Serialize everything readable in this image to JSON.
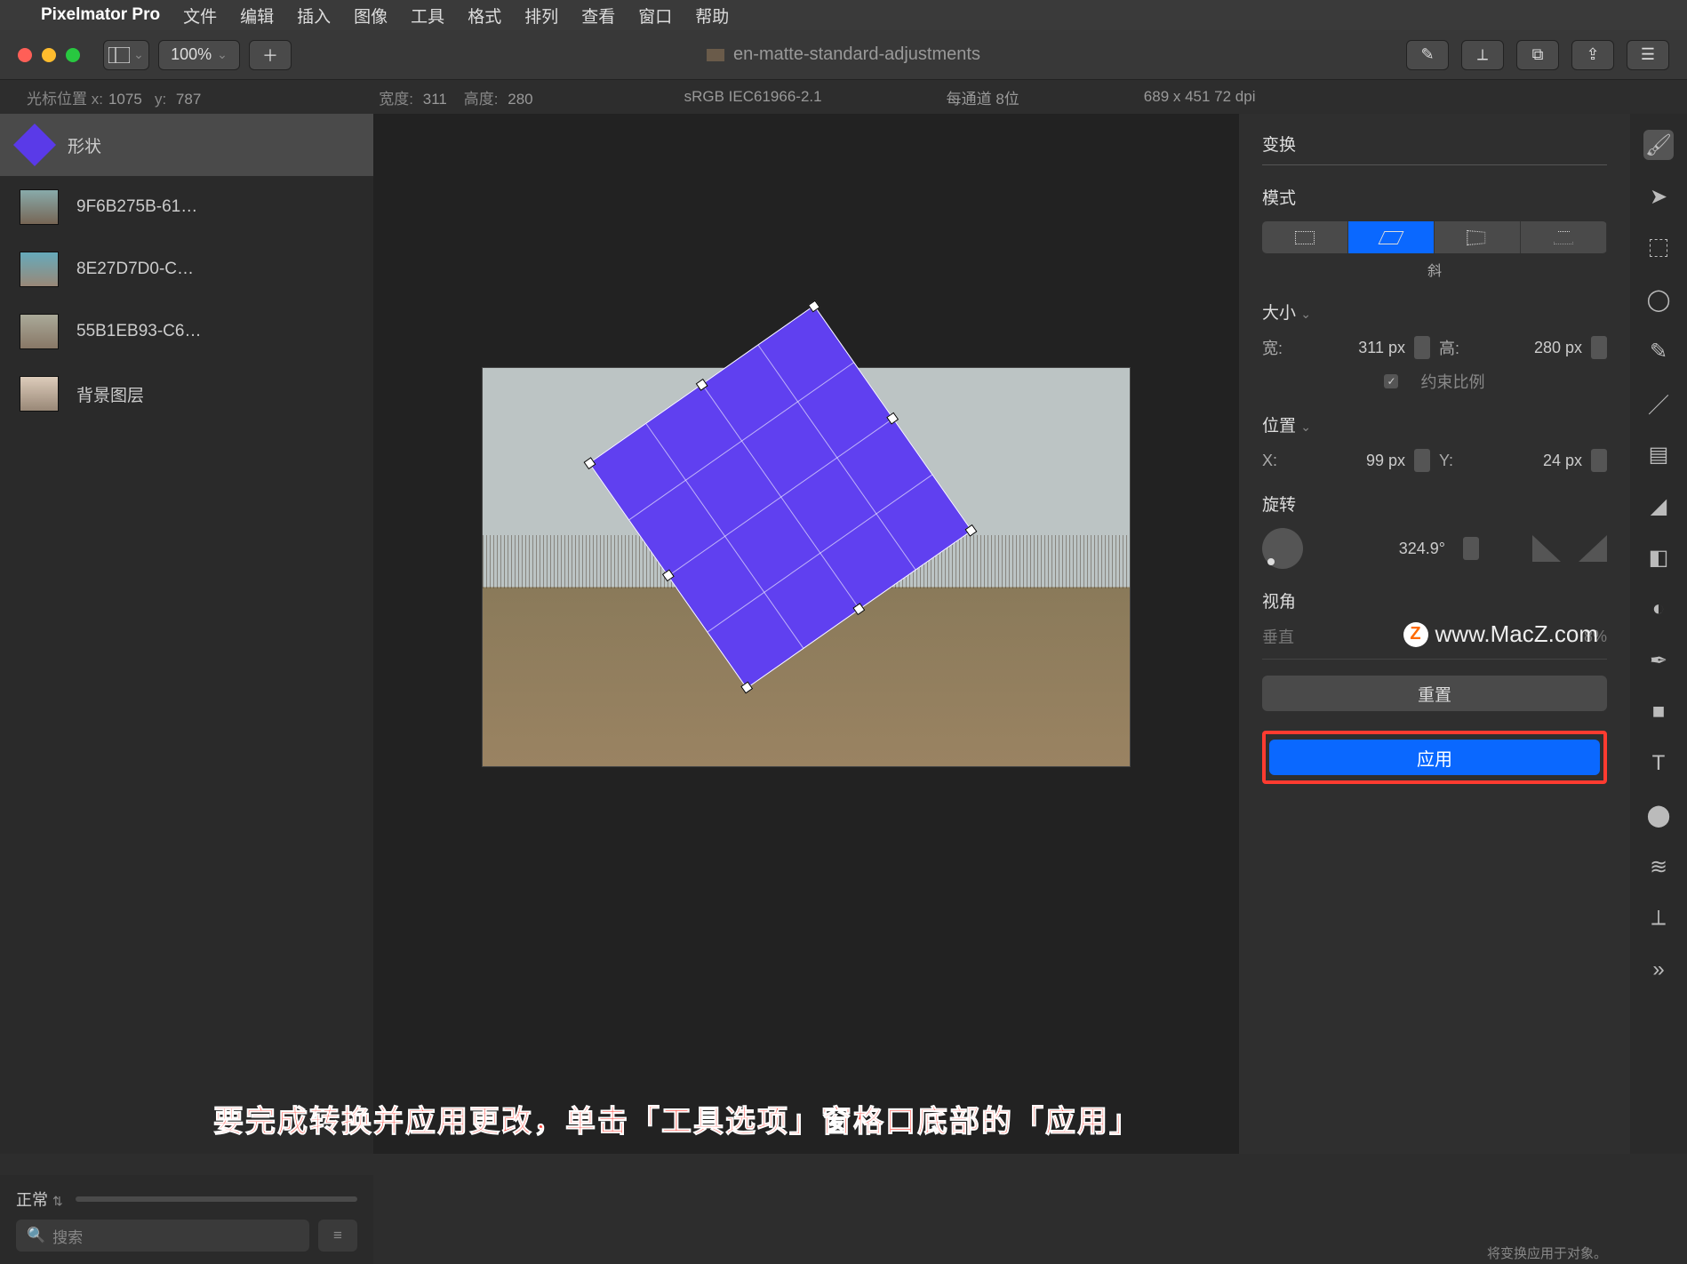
{
  "menubar": {
    "app": "Pixelmator Pro",
    "items": [
      "文件",
      "编辑",
      "插入",
      "图像",
      "工具",
      "格式",
      "排列",
      "查看",
      "窗口",
      "帮助"
    ]
  },
  "toolbar": {
    "zoom": "100%",
    "title": "en-matte-standard-adjustments"
  },
  "infobar": {
    "cursor_lbl": "光标位置 x:",
    "cursor_x": "1075",
    "cursor_y_lbl": "y:",
    "cursor_y": "787",
    "w_lbl": "宽度:",
    "w": "311",
    "h_lbl": "高度:",
    "h": "280",
    "profile": "sRGB IEC61966-2.1",
    "depth": "每通道 8位",
    "size": "689 x 451 72 dpi"
  },
  "layers": [
    {
      "name": "形状",
      "shape": true,
      "active": true
    },
    {
      "name": "9F6B275B-61…"
    },
    {
      "name": "8E27D7D0-C…"
    },
    {
      "name": "55B1EB93-C6…"
    },
    {
      "name": "背景图层"
    }
  ],
  "insp": {
    "transform": "变换",
    "mode_lbl": "模式",
    "mode_sel": "斜",
    "size_lbl": "大小",
    "w_lbl": "宽:",
    "w": "311 px",
    "h_lbl": "高:",
    "h": "280 px",
    "constrain": "约束比例",
    "pos_lbl": "位置",
    "x_lbl": "X:",
    "x": "99 px",
    "y_lbl": "Y:",
    "y": "24 px",
    "rot_lbl": "旋转",
    "rot": "324.9°",
    "persp_lbl": "视角",
    "persp_axis": "垂直",
    "persp_val": "8%",
    "reset": "重置",
    "apply": "应用",
    "apply_hint": "将变换应用于对象。"
  },
  "bottom": {
    "blend": "正常",
    "search": "搜索"
  },
  "overlay": "要完成转换并应用更改，单击「工具选项」窗格口底部的「应用」",
  "watermark": "www.MacZ.com"
}
